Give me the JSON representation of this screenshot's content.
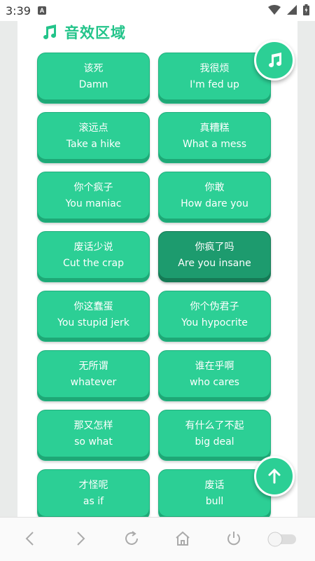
{
  "status": {
    "time": "3:39",
    "notification_badge": "A"
  },
  "section": {
    "title": "音效区域",
    "icon": "music-note-icon"
  },
  "sounds": [
    {
      "zh": "该死",
      "en": "Damn"
    },
    {
      "zh": "我很烦",
      "en": "I'm fed up"
    },
    {
      "zh": "滚远点",
      "en": "Take a hike"
    },
    {
      "zh": "真糟糕",
      "en": "What a mess"
    },
    {
      "zh": "你个疯子",
      "en": "You maniac"
    },
    {
      "zh": "你敢",
      "en": "How dare you"
    },
    {
      "zh": "废话少说",
      "en": "Cut the crap"
    },
    {
      "zh": "你疯了吗",
      "en": "Are you insane"
    },
    {
      "zh": "你这蠢蛋",
      "en": "You stupid jerk"
    },
    {
      "zh": "你个伪君子",
      "en": "You hypocrite"
    },
    {
      "zh": "无所谓",
      "en": "whatever"
    },
    {
      "zh": "谁在乎啊",
      "en": "who cares"
    },
    {
      "zh": "那又怎样",
      "en": "so what"
    },
    {
      "zh": "有什么了不起",
      "en": "big deal"
    },
    {
      "zh": "才怪呢",
      "en": "as if"
    },
    {
      "zh": "废话",
      "en": "bull"
    }
  ],
  "active_index": 7,
  "colors": {
    "accent": "#2ccf95",
    "accent_dark": "#1d9b6e"
  }
}
